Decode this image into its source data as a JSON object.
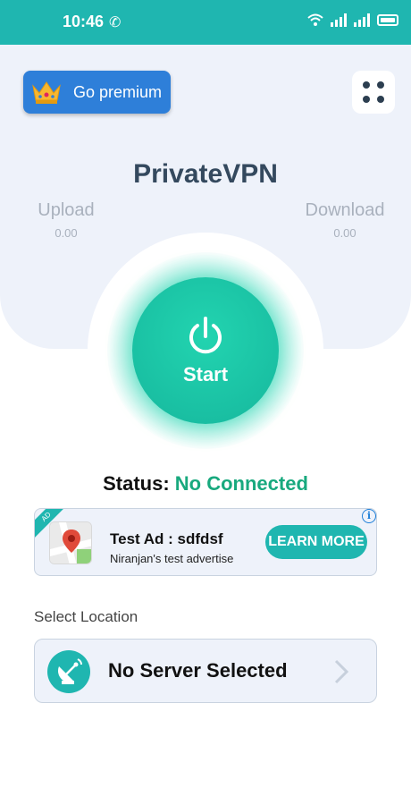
{
  "status_bar": {
    "time": "10:46",
    "icons": [
      "missed-call-icon",
      "wifi-icon",
      "signal-icon",
      "signal-icon",
      "battery-icon"
    ]
  },
  "premium": {
    "label": "Go premium",
    "icon": "crown-icon"
  },
  "menu": {
    "icon": "grid-dots-icon"
  },
  "app": {
    "title": "PrivateVPN"
  },
  "stats": {
    "upload_label": "Upload",
    "upload_value": "0.00",
    "download_label": "Download",
    "download_value": "0.00"
  },
  "connect": {
    "label": "Start",
    "icon": "power-icon"
  },
  "status": {
    "key": "Status:",
    "value": "No Connected"
  },
  "ad": {
    "badge": "AD",
    "title": "Test Ad : sdfdsf",
    "subtitle": "Niranjan's test advertise",
    "cta": "LEARN MORE",
    "info": "i",
    "icon": "map-icon"
  },
  "location": {
    "label": "Select Location",
    "server_name": "No Server Selected",
    "icon": "satellite-dish-icon"
  },
  "colors": {
    "accent": "#1fb6b0",
    "premium_button": "#2e7fd9",
    "connect_green": "#18a97e",
    "panel_bg": "#eef2fa"
  }
}
